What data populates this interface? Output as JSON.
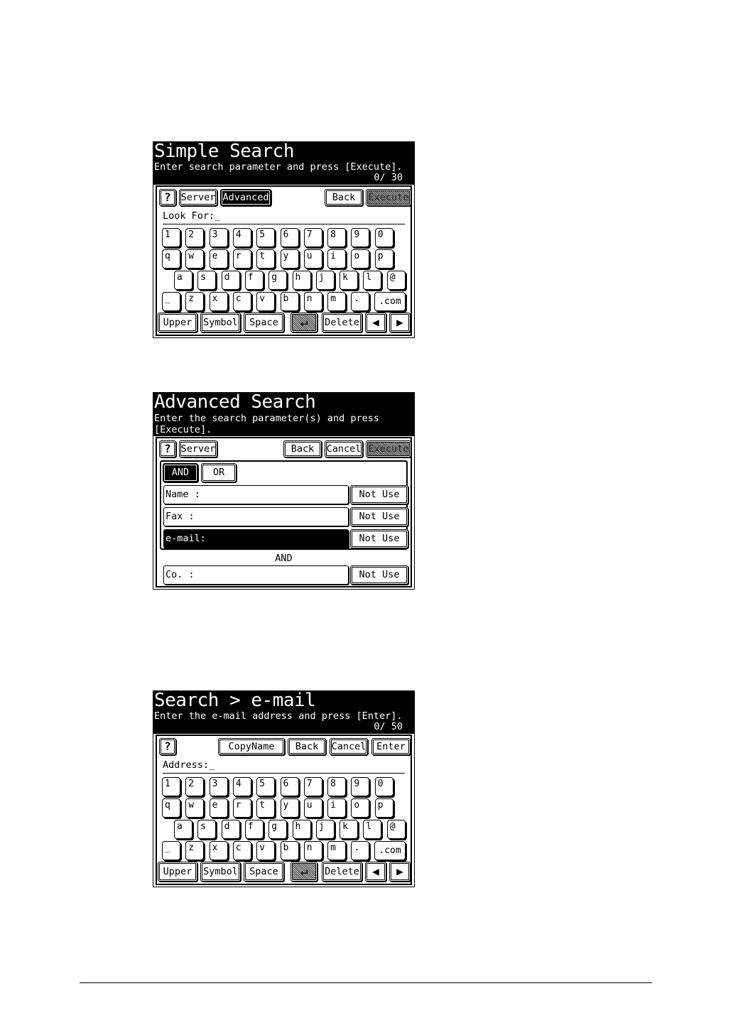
{
  "screens": {
    "simple": {
      "title": "Simple Search",
      "subtitle": "Enter search parameter and press [Execute].",
      "counter": "0/ 30",
      "help": "?",
      "server": "Server",
      "advanced": "Advanced",
      "back": "Back",
      "execute": "Execute",
      "field_label": "Look For:_",
      "bottom": {
        "upper": "Upper",
        "symbol": "Symbol",
        "space": "Space",
        "enter": "↵",
        "delete": "Delete",
        "left": "◀",
        "right": "▶"
      }
    },
    "advanced": {
      "title": "Advanced Search",
      "subtitle1": "Enter the search parameter(s) and press",
      "subtitle2": "[Execute].",
      "help": "?",
      "server": "Server",
      "back": "Back",
      "cancel": "Cancel",
      "execute": "Execute",
      "and": "AND",
      "or": "OR",
      "rows": [
        {
          "label": "Name  :",
          "button": "Not Use"
        },
        {
          "label": "Fax   :",
          "button": "Not Use"
        },
        {
          "label": "e-mail:",
          "button": "Not Use"
        }
      ],
      "join_label": "AND",
      "co_row": {
        "label": "Co.   :",
        "button": "Not Use"
      }
    },
    "email": {
      "title": "Search > e-mail",
      "subtitle": "Enter the e-mail address and press [Enter].",
      "counter": "0/ 50",
      "help": "?",
      "copyname": "CopyName",
      "back": "Back",
      "cancel": "Cancel",
      "enter": "Enter",
      "field_label": "Address:_",
      "bottom": {
        "upper": "Upper",
        "symbol": "Symbol",
        "space": "Space",
        "enter": "↵",
        "delete": "Delete",
        "left": "◀",
        "right": "▶"
      }
    }
  },
  "keyboard": {
    "row1": [
      "1",
      "2",
      "3",
      "4",
      "5",
      "6",
      "7",
      "8",
      "9",
      "0"
    ],
    "row2": [
      "q",
      "w",
      "e",
      "r",
      "t",
      "y",
      "u",
      "i",
      "o",
      "p"
    ],
    "row3": [
      "a",
      "s",
      "d",
      "f",
      "g",
      "h",
      "j",
      "k",
      "l",
      "@"
    ],
    "row4": [
      "_",
      "z",
      "x",
      "c",
      "v",
      "b",
      "n",
      "m",
      "."
    ],
    "dotcom": ".com"
  }
}
